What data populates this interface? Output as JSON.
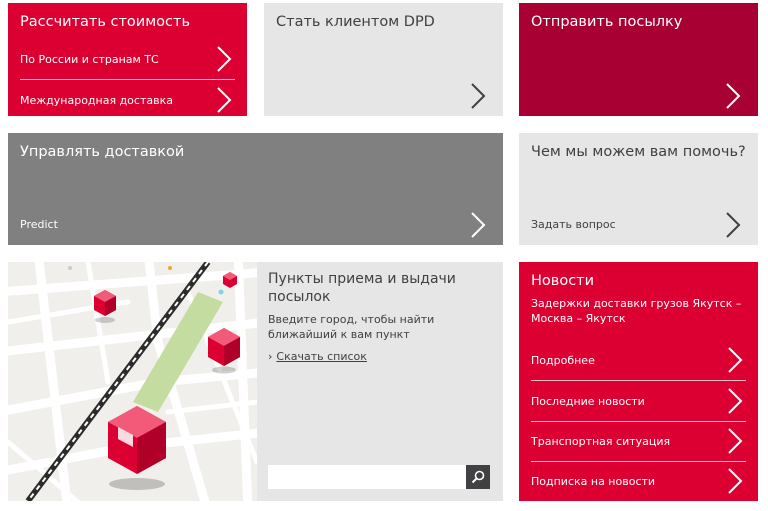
{
  "calc": {
    "title": "Рассчитать стоимость",
    "items": [
      {
        "label": "По России и странам ТС"
      },
      {
        "label": "Международная доставка"
      }
    ]
  },
  "client": {
    "title": "Стать клиентом DPD"
  },
  "send": {
    "title": "Отправить посылку"
  },
  "manage": {
    "title": "Управлять доставкой",
    "link": "Predict"
  },
  "help": {
    "title": "Чем мы можем вам помочь?",
    "link": "Задать вопрос"
  },
  "pickup": {
    "title": "Пункты приема и выдачи посылок",
    "description": "Введите город, чтобы найти ближайший к вам пункт",
    "link_arrow": "›",
    "link": "Скачать список",
    "search_placeholder": ""
  },
  "news": {
    "title": "Новости",
    "headline": "Задержки доставки грузов Якутск – Москва – Якутск",
    "items": [
      {
        "label": "Подробнее"
      },
      {
        "label": "Последние новости"
      },
      {
        "label": "Транспортная ситуация"
      },
      {
        "label": "Подписка на новости"
      }
    ]
  },
  "icons": {
    "chevron": "chevron-right-icon",
    "search": "search-icon",
    "parcel": "parcel-cube-icon"
  },
  "colors": {
    "red": "#dc0032",
    "wine": "#a90034",
    "grey": "#e6e6e6",
    "dark_grey": "#808080",
    "text_dark": "#414042"
  }
}
